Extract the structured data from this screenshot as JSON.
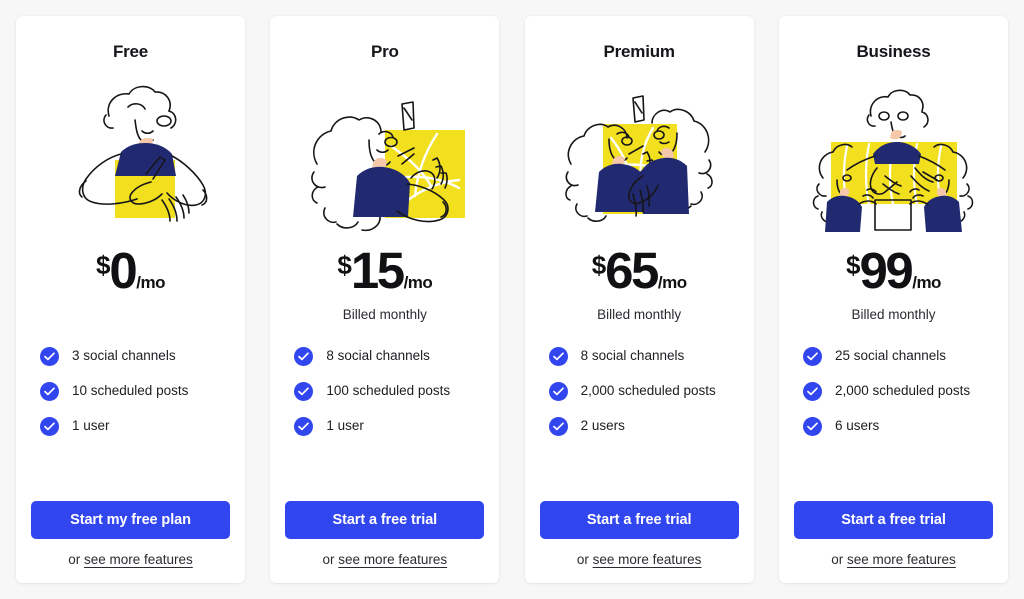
{
  "theme": {
    "page_background": "#f7f7f8",
    "card_background": "#ffffff",
    "accent_blue": "#3246ef",
    "illustration_yellow": "#f2df1e",
    "illustration_navy": "#212a70",
    "illustration_skin": "#f4c8a8",
    "text_dark": "#16161a"
  },
  "plans": [
    {
      "name": "Free",
      "currency": "$",
      "amount": "0",
      "period": "/mo",
      "billed": "",
      "illustration": "person-writing-illustration",
      "features": [
        "3 social channels",
        "10 scheduled posts",
        "1 user"
      ],
      "cta_label": "Start my free plan",
      "sub_prefix": "or ",
      "sub_link": "see more features"
    },
    {
      "name": "Pro",
      "currency": "$",
      "amount": "15",
      "period": "/mo",
      "billed": "Billed monthly",
      "illustration": "person-pointing-at-board-illustration",
      "features": [
        "8 social channels",
        "100 scheduled posts",
        "1 user"
      ],
      "cta_label": "Start a free trial",
      "sub_prefix": "or ",
      "sub_link": "see more features"
    },
    {
      "name": "Premium",
      "currency": "$",
      "amount": "65",
      "period": "/mo",
      "billed": "Billed monthly",
      "illustration": "two-people-at-board-illustration",
      "features": [
        "8 social channels",
        "2,000 scheduled posts",
        "2 users"
      ],
      "cta_label": "Start a free trial",
      "sub_prefix": "or ",
      "sub_link": "see more features"
    },
    {
      "name": "Business",
      "currency": "$",
      "amount": "99",
      "period": "/mo",
      "billed": "Billed monthly",
      "illustration": "three-people-team-board-illustration",
      "features": [
        "25 social channels",
        "2,000 scheduled posts",
        "6 users"
      ],
      "cta_label": "Start a free trial",
      "sub_prefix": "or ",
      "sub_link": "see more features"
    }
  ]
}
